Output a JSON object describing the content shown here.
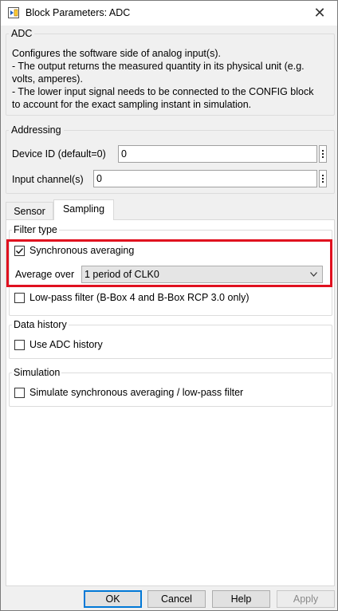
{
  "window": {
    "title": "Block Parameters: ADC",
    "close_symbol": "✕"
  },
  "description": {
    "group_label": "ADC",
    "lines": [
      "Configures the software side of analog input(s).",
      "- The output returns the measured quantity in its physical unit (e.g.",
      "volts, amperes).",
      "- The lower input signal needs to be connected to the CONFIG block",
      "to account for the exact sampling instant in simulation."
    ]
  },
  "addressing": {
    "group_label": "Addressing",
    "device_id_label": "Device ID (default=0)",
    "device_id_value": "0",
    "input_channel_label": "Input channel(s)",
    "input_channel_value": "0"
  },
  "tabs": [
    {
      "label": "Sensor",
      "active": false
    },
    {
      "label": "Sampling",
      "active": true
    }
  ],
  "filter_type": {
    "group_label": "Filter type",
    "sync_avg_label": "Synchronous averaging",
    "sync_avg_checked": true,
    "average_over_label": "Average over",
    "average_over_value": "1 period of CLK0",
    "lowpass_label": "Low-pass filter (B-Box 4 and B-Box RCP 3.0 only)",
    "lowpass_checked": false
  },
  "data_history": {
    "group_label": "Data history",
    "use_history_label": "Use ADC history",
    "use_history_checked": false
  },
  "simulation": {
    "group_label": "Simulation",
    "simulate_label": "Simulate synchronous averaging / low-pass filter",
    "simulate_checked": false
  },
  "buttons": {
    "ok": "OK",
    "cancel": "Cancel",
    "help": "Help",
    "apply": "Apply"
  },
  "colors": {
    "highlight": "#e0101f",
    "default_button_border": "#0078d7"
  }
}
